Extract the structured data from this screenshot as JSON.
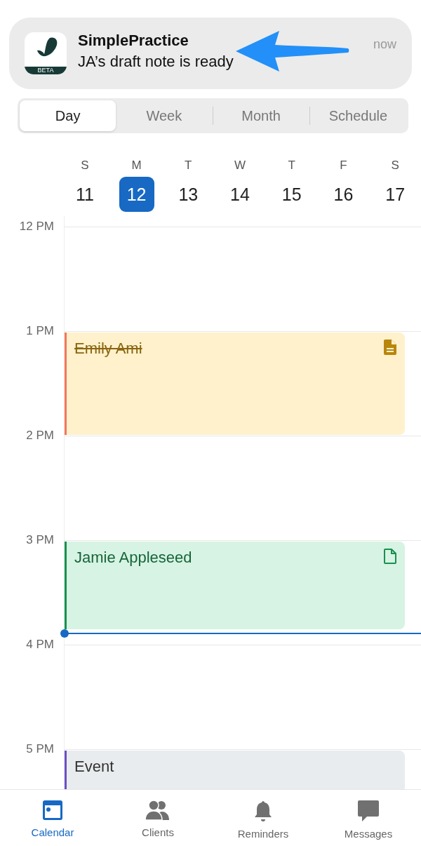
{
  "notification": {
    "app_badge": "BETA",
    "title": "SimplePractice",
    "message": "JA’s draft note is ready",
    "time": "now"
  },
  "view_tabs": [
    {
      "label": "Day",
      "selected": true
    },
    {
      "label": "Week",
      "selected": false
    },
    {
      "label": "Month",
      "selected": false
    },
    {
      "label": "Schedule",
      "selected": false
    }
  ],
  "week": [
    {
      "weekday": "S",
      "date": "11",
      "selected": false
    },
    {
      "weekday": "M",
      "date": "12",
      "selected": true
    },
    {
      "weekday": "T",
      "date": "13",
      "selected": false
    },
    {
      "weekday": "W",
      "date": "14",
      "selected": false
    },
    {
      "weekday": "T",
      "date": "15",
      "selected": false
    },
    {
      "weekday": "F",
      "date": "16",
      "selected": false
    },
    {
      "weekday": "S",
      "date": "17",
      "selected": false
    }
  ],
  "hours": [
    {
      "label": "12 PM"
    },
    {
      "label": "1 PM",
      "events": [
        {
          "kind": "yellow",
          "title": "Emily Ami",
          "cancelled": true,
          "icon": {
            "kind": "filled"
          },
          "color": "#f2775a"
        }
      ]
    },
    {
      "label": "2 PM"
    },
    {
      "label": "3 PM",
      "now": true,
      "events": [
        {
          "kind": "green",
          "title": "Jamie Appleseed",
          "cancelled": false,
          "icon": {
            "kind": "outline"
          },
          "color": "#17914f"
        }
      ]
    },
    {
      "label": "4 PM"
    },
    {
      "label": "5 PM",
      "events": [
        {
          "kind": "grey",
          "title": "Event",
          "cancelled": false,
          "color": "#6a4fc4"
        }
      ]
    }
  ],
  "bottom_tabs": [
    {
      "kind": "calendar",
      "label": "Calendar",
      "selected": true
    },
    {
      "kind": "clients",
      "label": "Clients",
      "selected": false
    },
    {
      "kind": "reminders",
      "label": "Reminders",
      "selected": false
    },
    {
      "kind": "messages",
      "label": "Messages",
      "selected": false
    }
  ]
}
